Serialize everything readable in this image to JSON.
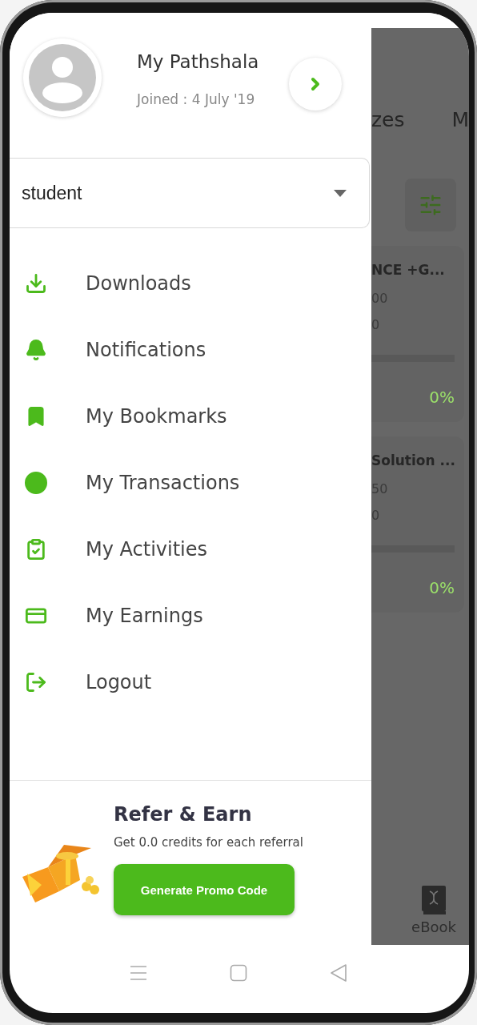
{
  "profile": {
    "name": "My Pathshala",
    "joined": "Joined : 4 July '19"
  },
  "role_select": {
    "value": "student"
  },
  "menu": [
    {
      "label": "Downloads"
    },
    {
      "label": "Notifications"
    },
    {
      "label": "My Bookmarks"
    },
    {
      "label": "My Transactions"
    },
    {
      "label": "My Activities"
    },
    {
      "label": "My Earnings"
    },
    {
      "label": "Logout"
    }
  ],
  "refer": {
    "title": "Refer & Earn",
    "text": "Get 0.0 credits for each referral",
    "button": "Generate Promo Code"
  },
  "background_screen": {
    "tabs": [
      "zes",
      "M"
    ],
    "cards": [
      {
        "title": "NCE +G...",
        "line_1": "00",
        "line_2": "0",
        "percent": "0%"
      },
      {
        "title": "Solution ...",
        "line_1": "50",
        "line_2": "0",
        "percent": "0%"
      }
    ],
    "bottom_tab": "eBook"
  }
}
